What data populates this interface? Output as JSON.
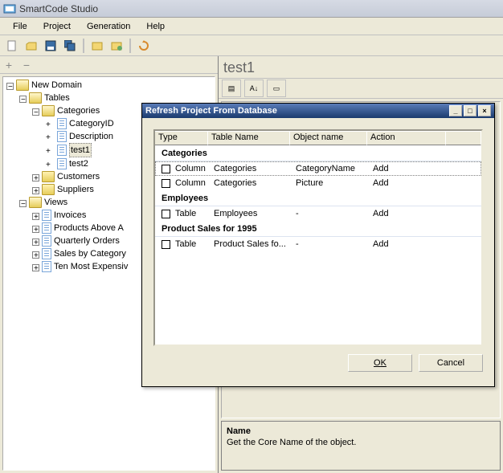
{
  "app": {
    "title": "SmartCode Studio"
  },
  "menu": {
    "file": "File",
    "project": "Project",
    "generation": "Generation",
    "help": "Help"
  },
  "tree": {
    "root": "New Domain",
    "tables": "Tables",
    "categories": "Categories",
    "categoryId": "CategoryID",
    "description": "Description",
    "test1": "test1",
    "test2": "test2",
    "customers": "Customers",
    "suppliers": "Suppliers",
    "views": "Views",
    "invoices": "Invoices",
    "productsAbove": "Products Above A",
    "quarterly": "Quarterly Orders",
    "salesByCat": "Sales by Category",
    "tenMost": "Ten Most Expensiv"
  },
  "detail": {
    "title": "test1",
    "prop_name_label": "Name",
    "prop_name_desc": "Get the Core Name of the object."
  },
  "dialog": {
    "title": "Refresh Project From Database",
    "headers": {
      "type": "Type",
      "table": "Table Name",
      "object": "Object name",
      "action": "Action"
    },
    "groups": [
      {
        "label": "Categories",
        "rows": [
          {
            "type": "Column",
            "table": "Categories",
            "object": "CategoryName",
            "action": "Add",
            "highlight": true
          },
          {
            "type": "Column",
            "table": "Categories",
            "object": "Picture",
            "action": "Add"
          }
        ]
      },
      {
        "label": "Employees",
        "rows": [
          {
            "type": "Table",
            "table": "Employees",
            "object": "-",
            "action": "Add"
          }
        ]
      },
      {
        "label": "Product Sales for 1995",
        "rows": [
          {
            "type": "Table",
            "table": "Product Sales fo...",
            "object": "-",
            "action": "Add"
          }
        ]
      }
    ],
    "ok": "OK",
    "cancel": "Cancel"
  }
}
